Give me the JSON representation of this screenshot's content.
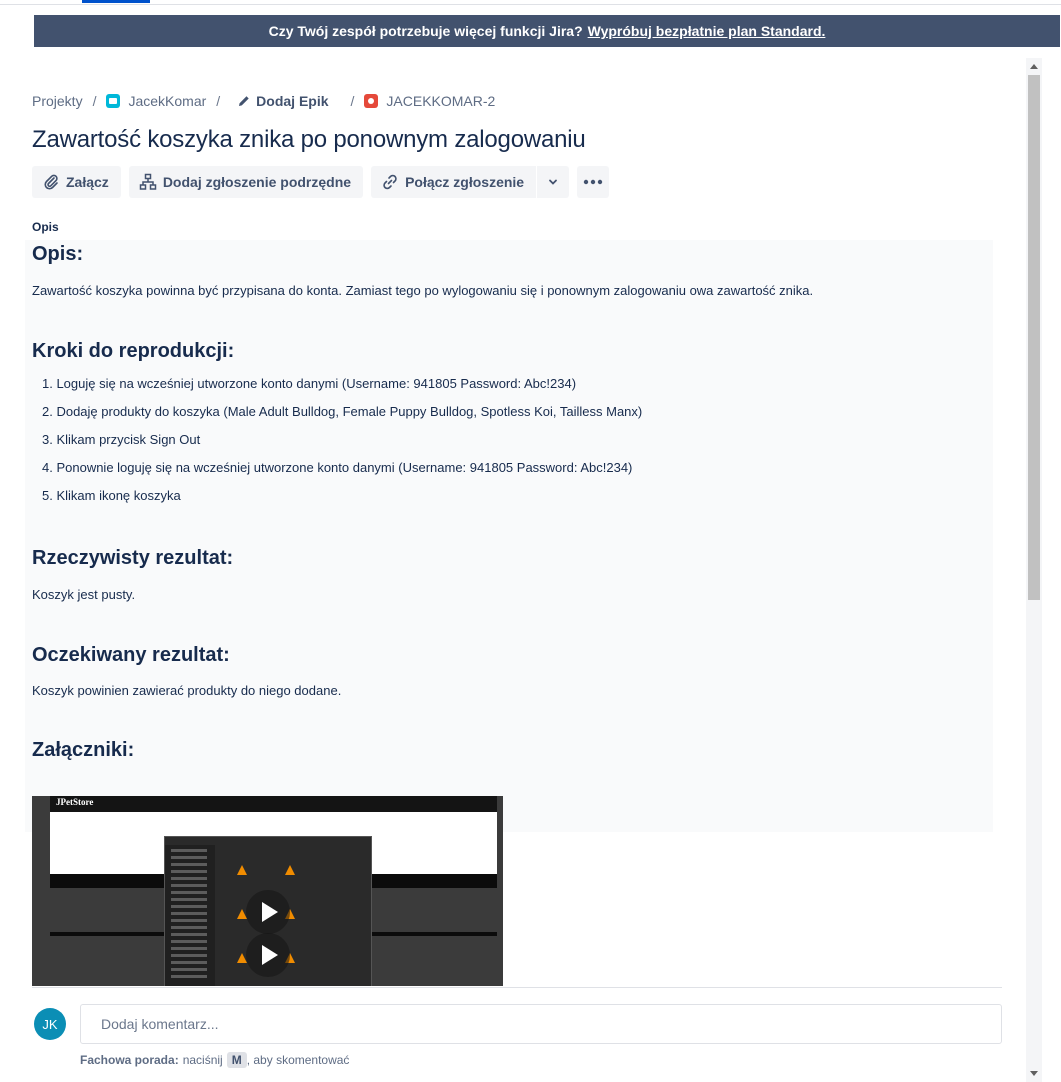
{
  "banner": {
    "text": "Czy Twój zespół potrzebuje więcej funkcji Jira?",
    "link": "Wypróbuj bezpłatnie plan Standard."
  },
  "breadcrumb": {
    "projects": "Projekty",
    "project": "JacekKomar",
    "epic": "Dodaj Epik",
    "issue": "JACEKKOMAR-2"
  },
  "issue": {
    "title": "Zawartość koszyka znika po ponownym zalogowaniu"
  },
  "toolbar": {
    "attach": "Załącz",
    "child": "Dodaj zgłoszenie podrzędne",
    "link": "Połącz zgłoszenie"
  },
  "description": {
    "label": "Opis",
    "heading": "Opis:",
    "text": "Zawartość koszyka powinna być przypisana do konta. Zamiast tego po wylogowaniu się i ponownym zalogowaniu owa zawartość znika.",
    "steps_heading": "Kroki do reprodukcji:",
    "steps": [
      "1. Loguję się na wcześniej utworzone konto danymi (Username: 941805 Password: Abc!234)",
      "2. Dodaję produkty do koszyka (Male Adult Bulldog, Female Puppy Bulldog, Spotless Koi, Tailless Manx)",
      "3. Klikam przycisk Sign Out",
      "4. Ponownie loguję się na wcześniej utworzone konto danymi (Username: 941805 Password: Abc!234)",
      "5. Klikam ikonę koszyka"
    ],
    "actual_heading": "Rzeczywisty rezultat:",
    "actual_text": "Koszyk jest pusty.",
    "expected_heading": "Oczekiwany rezultat:",
    "expected_text": "Koszyk powinien zawierać produkty do niego dodane.",
    "attachments_heading": "Załączniki:"
  },
  "attachment": {
    "logo": "JPetStore"
  },
  "comment": {
    "avatar": "JK",
    "placeholder": "Dodaj komentarz...",
    "tip_bold": "Fachowa porada:",
    "tip_pre": "naciśnij",
    "tip_key": "M",
    "tip_post": ", aby skomentować"
  }
}
